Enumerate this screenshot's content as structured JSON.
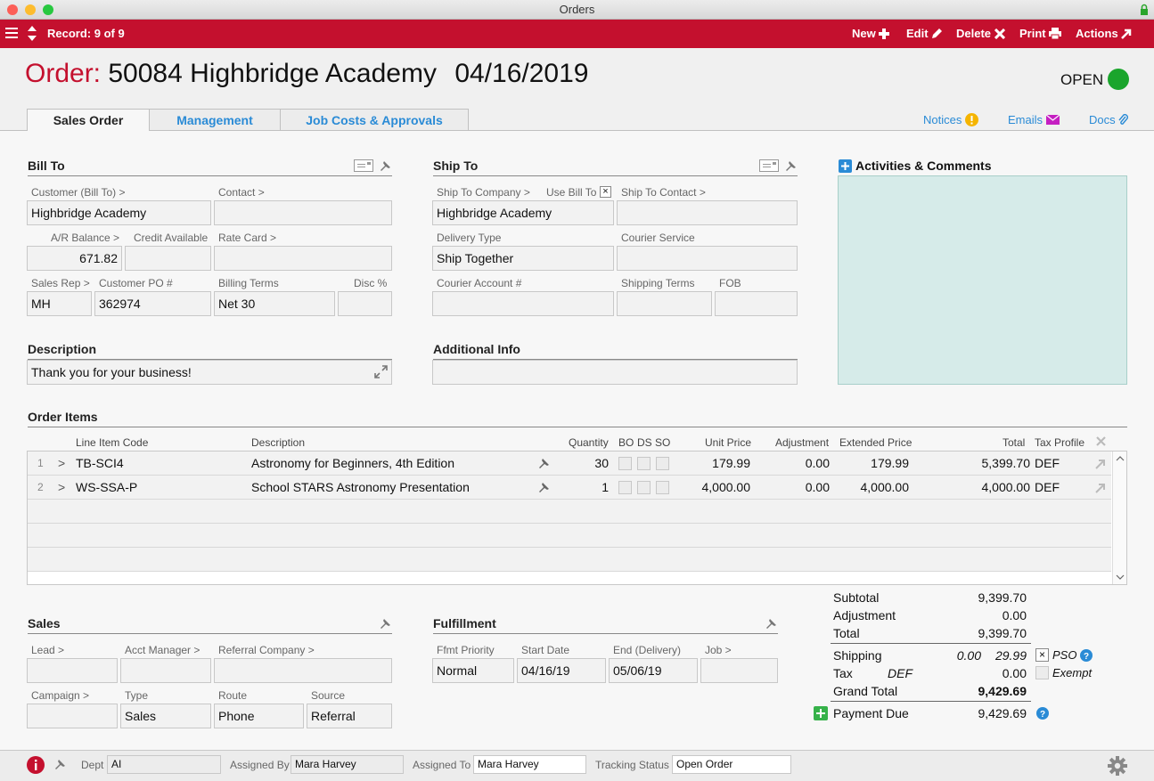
{
  "window": {
    "title": "Orders"
  },
  "toolbar": {
    "record": "Record: 9 of 9",
    "new": "New",
    "edit": "Edit",
    "delete": "Delete",
    "print": "Print",
    "actions": "Actions"
  },
  "header": {
    "order_label": "Order:",
    "order_title": "50084 Highbridge Academy",
    "order_date": "04/16/2019",
    "status": "OPEN",
    "status_color": "#1aa52c"
  },
  "tabs": [
    {
      "label": "Sales Order"
    },
    {
      "label": "Management"
    },
    {
      "label": "Job Costs & Approvals"
    }
  ],
  "links": {
    "notices": "Notices",
    "emails": "Emails",
    "docs": "Docs"
  },
  "bill_to": {
    "heading": "Bill To",
    "customer_label": "Customer (Bill To) >",
    "customer": "Highbridge Academy",
    "contact_label": "Contact >",
    "contact": "",
    "ar_label": "A/R Balance >",
    "ar": "671.82",
    "credit_label": "Credit Available",
    "credit": "",
    "rate_label": "Rate Card >",
    "rate": "",
    "rep_label": "Sales Rep >",
    "rep": "MH",
    "po_label": "Customer PO #",
    "po": "362974",
    "terms_label": "Billing Terms",
    "terms": "Net 30",
    "disc_label": "Disc %",
    "disc": ""
  },
  "ship_to": {
    "heading": "Ship To",
    "company_label": "Ship To Company >",
    "use_bill_label": "Use Bill To",
    "use_bill": "×",
    "company": "Highbridge Academy",
    "contact_label": "Ship To Contact >",
    "contact": "",
    "delivery_label": "Delivery Type",
    "delivery": "Ship Together",
    "courier_label": "Courier Service",
    "courier": "",
    "account_label": "Courier Account #",
    "account": "",
    "ship_terms_label": "Shipping Terms",
    "ship_terms": "",
    "fob_label": "FOB",
    "fob": ""
  },
  "activities": {
    "heading": "Activities & Comments"
  },
  "description": {
    "heading": "Description",
    "value": "Thank you for your business!"
  },
  "additional": {
    "heading": "Additional Info",
    "value": ""
  },
  "order_items": {
    "heading": "Order Items",
    "columns": {
      "code": "Line Item Code",
      "desc": "Description",
      "qty": "Quantity",
      "bo": "BO",
      "ds": "DS",
      "so": "SO",
      "unit": "Unit Price",
      "adj": "Adjustment",
      "ext": "Extended Price",
      "total": "Total",
      "tax": "Tax Profile"
    },
    "rows": [
      {
        "num": "1",
        "code": "TB-SCI4",
        "desc": "Astronomy for Beginners, 4th Edition",
        "qty": "30",
        "unit": "179.99",
        "adj": "0.00",
        "ext": "179.99",
        "total": "5,399.70",
        "tax": "DEF"
      },
      {
        "num": "2",
        "code": "WS-SSA-P",
        "desc": "School STARS Astronomy Presentation",
        "qty": "1",
        "unit": "4,000.00",
        "adj": "0.00",
        "ext": "4,000.00",
        "total": "4,000.00",
        "tax": "DEF"
      }
    ]
  },
  "sales": {
    "heading": "Sales",
    "lead_label": "Lead >",
    "lead": "",
    "acct_label": "Acct Manager >",
    "acct": "",
    "referral_label": "Referral Company >",
    "referral": "",
    "campaign_label": "Campaign >",
    "campaign": "",
    "type_label": "Type",
    "type": "Sales",
    "route_label": "Route",
    "route": "Phone",
    "source_label": "Source",
    "source": "Referral"
  },
  "fulfillment": {
    "heading": "Fulfillment",
    "priority_label": "Ffmt Priority",
    "priority": "Normal",
    "start_label": "Start Date",
    "start": "04/16/19",
    "end_label": "End (Delivery)",
    "end": "05/06/19",
    "job_label": "Job >",
    "job": ""
  },
  "totals": {
    "subtotal_label": "Subtotal",
    "subtotal": "9,399.70",
    "adjustment_label": "Adjustment",
    "adjustment": "0.00",
    "total_label": "Total",
    "total": "9,399.70",
    "shipping_label": "Shipping",
    "shipping_a": "0.00",
    "shipping_b": "29.99",
    "pso_label": "PSO",
    "pso_check": "×",
    "tax_label": "Tax",
    "tax_profile": "DEF",
    "tax": "0.00",
    "exempt_label": "Exempt",
    "grand_label": "Grand Total",
    "grand": "9,429.69",
    "payment_label": "Payment Due",
    "payment": "9,429.69"
  },
  "footer": {
    "dept_label": "Dept",
    "dept": "AI",
    "assigned_by_label": "Assigned By",
    "assigned_by": "Mara Harvey",
    "assigned_to_label": "Assigned To",
    "assigned_to": "Mara Harvey",
    "tracking_label": "Tracking Status",
    "tracking": "Open Order"
  }
}
